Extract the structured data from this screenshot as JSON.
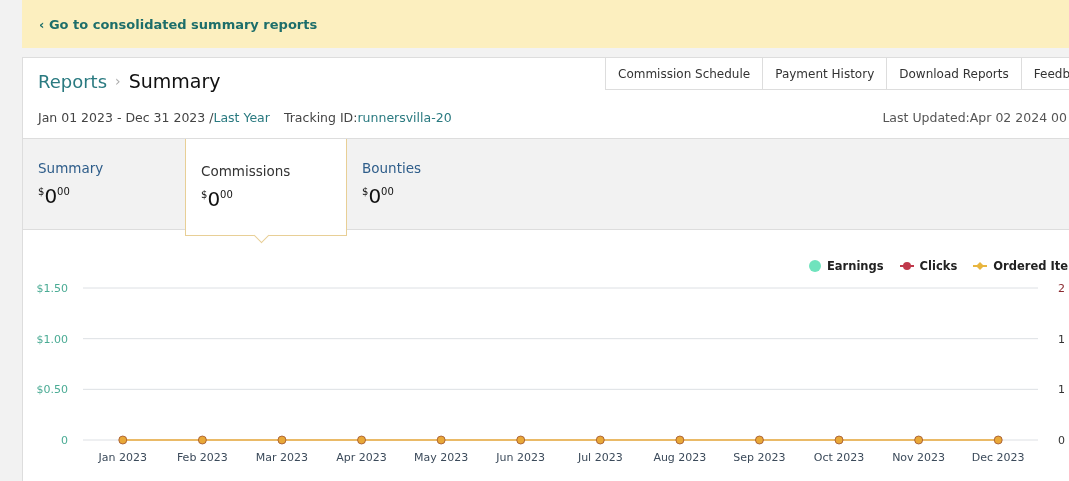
{
  "banner": {
    "link": "‹ Go to consolidated summary reports"
  },
  "breadcrumb": {
    "parent": "Reports",
    "separator": "›",
    "current": "Summary"
  },
  "top_tabs": [
    {
      "label": "Commission Schedule"
    },
    {
      "label": "Payment History"
    },
    {
      "label": "Download Reports"
    },
    {
      "label": "Feedb"
    }
  ],
  "date_range": {
    "text": "Jan 01 2023 - Dec 31 2023 /",
    "period": "Last Year"
  },
  "tracking": {
    "label": "Tracking ID:",
    "value": "runnersvilla-20"
  },
  "last_updated": "Last Updated:Apr 02 2024 00",
  "summary_tabs": [
    {
      "title": "Summary",
      "currency": "$",
      "whole": "0",
      "fraction": "00",
      "selected": false
    },
    {
      "title": "Commissions",
      "currency": "$",
      "whole": "0",
      "fraction": "00",
      "selected": true
    },
    {
      "title": "Bounties",
      "currency": "$",
      "whole": "0",
      "fraction": "00",
      "selected": false
    }
  ],
  "legend": [
    {
      "label": "Earnings",
      "kind": "circle",
      "color": "#6fe3bd"
    },
    {
      "label": "Clicks",
      "kind": "line-dot",
      "color": "#c0394b"
    },
    {
      "label": "Ordered Ite",
      "kind": "line-diamond",
      "color": "#e8b53e"
    }
  ],
  "right_axis_labels": [
    "2",
    "1",
    "1",
    "0"
  ],
  "chart_data": {
    "type": "line",
    "x": [
      "Jan 2023",
      "Feb 2023",
      "Mar 2023",
      "Apr 2023",
      "May 2023",
      "Jun 2023",
      "Jul 2023",
      "Aug 2023",
      "Sep 2023",
      "Oct 2023",
      "Nov 2023",
      "Dec 2023"
    ],
    "series": [
      {
        "color": "#e8a838",
        "marker": "circle",
        "values": [
          0,
          0,
          0,
          0,
          0,
          0,
          0,
          0,
          0,
          0,
          0,
          0
        ]
      }
    ],
    "ylim": [
      0,
      1.5
    ],
    "yticks": [
      {
        "value": 0,
        "label": "0"
      },
      {
        "value": 0.5,
        "label": "$0.50"
      },
      {
        "value": 1,
        "label": "$1.00"
      },
      {
        "value": 1.5,
        "label": "$1.50"
      }
    ]
  }
}
